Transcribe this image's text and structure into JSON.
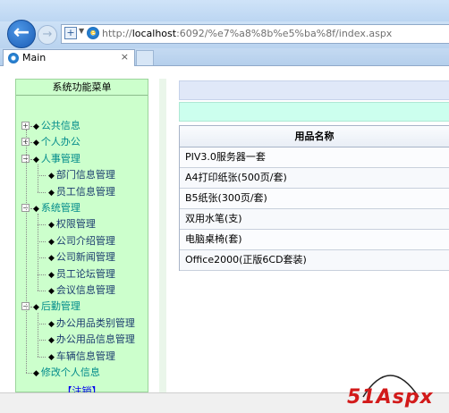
{
  "browser": {
    "url_prefix": "http://",
    "url_host": "localhost",
    "url_rest": ":6092/%e7%a8%8b%e5%ba%8f/index.aspx",
    "tab_title": "Main",
    "tab_close": "×",
    "back_glyph": "←",
    "forward_glyph": "→"
  },
  "sidebar": {
    "title": "系统功能菜单",
    "groups": [
      {
        "label": "公共信息",
        "expanded": false,
        "children": []
      },
      {
        "label": "个人办公",
        "expanded": false,
        "children": []
      },
      {
        "label": "人事管理",
        "expanded": true,
        "children": [
          "部门信息管理",
          "员工信息管理"
        ]
      },
      {
        "label": "系统管理",
        "expanded": true,
        "children": [
          "权限管理",
          "公司介绍管理",
          "公司新闻管理",
          "员工论坛管理",
          "会议信息管理"
        ]
      },
      {
        "label": "后勤管理",
        "expanded": true,
        "children": [
          "办公用品类别管理",
          "办公用品信息管理",
          "车辆信息管理"
        ]
      },
      {
        "label": "修改个人信息",
        "expanded": null,
        "children": []
      }
    ],
    "logout": "【注销】"
  },
  "table": {
    "header": "用品名称",
    "rows": [
      "PIV3.0服务器一套",
      "A4打印纸张(500页/套)",
      "B5纸张(300页/套)",
      "双用水笔(支)",
      "电脑桌椅(套)",
      "Office2000(正版6CD套装)"
    ]
  },
  "watermark": {
    "text": "51Aspx"
  }
}
